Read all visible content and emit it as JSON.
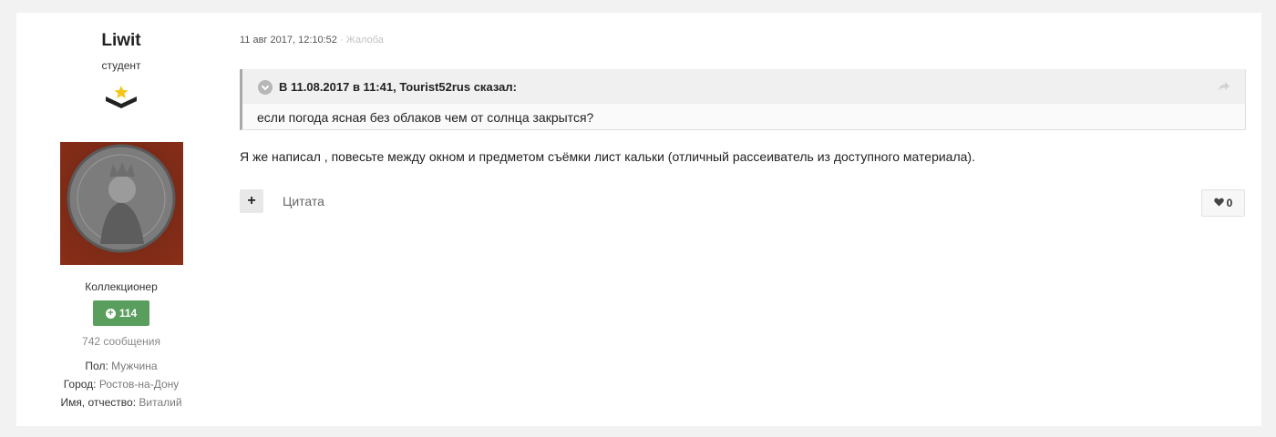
{
  "author": {
    "name": "Liwit",
    "title": "студент",
    "group": "Коллекционер",
    "reputation": "114",
    "post_count": "742 сообщения",
    "fields": [
      {
        "label": "Пол:",
        "value": "Мужчина"
      },
      {
        "label": "Город:",
        "value": "Ростов-на-Дону"
      },
      {
        "label": "Имя, отчество:",
        "value": "Виталий"
      }
    ]
  },
  "post": {
    "date": "11 авг 2017, 12:10:52",
    "separator": "·",
    "report_label": "Жалоба",
    "quote": {
      "citation": "В 11.08.2017 в 11:41, Tourist52rus сказал:",
      "text": "если погода ясная без облаков чем от солнца закрытся?"
    },
    "text": "Я же написал , повесьте между окном и предметом съёмки лист кальки (отличный рассеиватель из доступного материала).",
    "quote_button": "Цитата",
    "multiquote_symbol": "+",
    "likes": "0"
  },
  "colors": {
    "page_bg": "#f2f2f2",
    "reputation_green": "#5a9e5e",
    "avatar_bg": "#8b2e17",
    "star": "#f5c518"
  },
  "icons": [
    "rank-star-chevron-icon",
    "plus-circle-icon",
    "chevron-down-icon",
    "share-icon",
    "heart-icon"
  ]
}
